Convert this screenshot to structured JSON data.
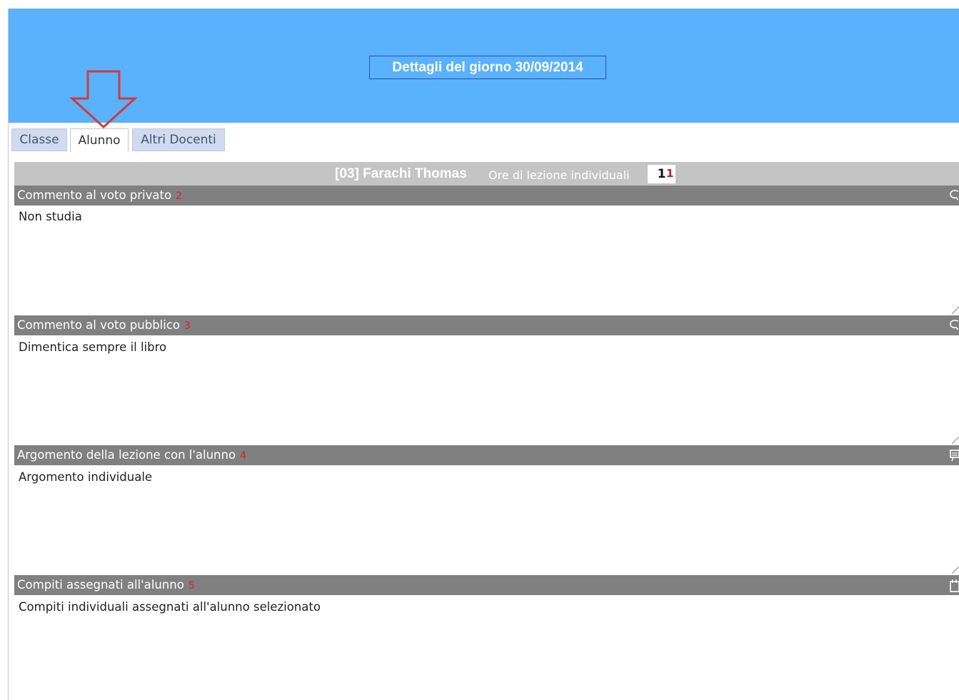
{
  "header": {
    "title": "Dettagli del giorno 30/09/2014",
    "background": "#5ab1fc"
  },
  "annotation": {
    "icon": "down-arrow-outline-icon",
    "color": "#d23a3a"
  },
  "tabs": [
    {
      "label": "Classe",
      "active": false
    },
    {
      "label": "Alunno",
      "active": true
    },
    {
      "label": "Altri Docenti",
      "active": false
    }
  ],
  "student": {
    "name": "[03] Farachi Thomas",
    "hours_label": "Ore di lezione individuali",
    "hours_value": "1",
    "marker": "1"
  },
  "sections": [
    {
      "title": "Commento al voto privato",
      "marker": "2",
      "text": "Non studia",
      "icon": "comment-icon"
    },
    {
      "title": "Commento al voto pubblico",
      "marker": "3",
      "text": "Dimentica sempre il libro",
      "icon": "comment-icon"
    },
    {
      "title": "Argomento della lezione con l'alunno",
      "marker": "4",
      "text": "Argomento individuale",
      "icon": "topic-icon"
    },
    {
      "title": "Compiti assegnati all'alunno",
      "marker": "5",
      "text": "Compiti individuali assegnati all'alunno selezionato",
      "icon": "homework-icon"
    }
  ]
}
